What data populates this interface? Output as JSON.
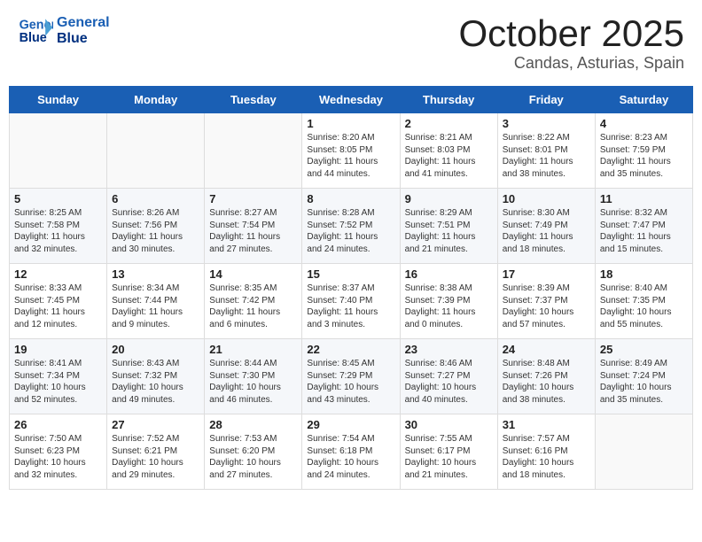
{
  "header": {
    "logo_line1": "General",
    "logo_line2": "Blue",
    "month": "October 2025",
    "location": "Candas, Asturias, Spain"
  },
  "days_of_week": [
    "Sunday",
    "Monday",
    "Tuesday",
    "Wednesday",
    "Thursday",
    "Friday",
    "Saturday"
  ],
  "weeks": [
    [
      {
        "day": "",
        "info": ""
      },
      {
        "day": "",
        "info": ""
      },
      {
        "day": "",
        "info": ""
      },
      {
        "day": "1",
        "info": "Sunrise: 8:20 AM\nSunset: 8:05 PM\nDaylight: 11 hours and 44 minutes."
      },
      {
        "day": "2",
        "info": "Sunrise: 8:21 AM\nSunset: 8:03 PM\nDaylight: 11 hours and 41 minutes."
      },
      {
        "day": "3",
        "info": "Sunrise: 8:22 AM\nSunset: 8:01 PM\nDaylight: 11 hours and 38 minutes."
      },
      {
        "day": "4",
        "info": "Sunrise: 8:23 AM\nSunset: 7:59 PM\nDaylight: 11 hours and 35 minutes."
      }
    ],
    [
      {
        "day": "5",
        "info": "Sunrise: 8:25 AM\nSunset: 7:58 PM\nDaylight: 11 hours and 32 minutes."
      },
      {
        "day": "6",
        "info": "Sunrise: 8:26 AM\nSunset: 7:56 PM\nDaylight: 11 hours and 30 minutes."
      },
      {
        "day": "7",
        "info": "Sunrise: 8:27 AM\nSunset: 7:54 PM\nDaylight: 11 hours and 27 minutes."
      },
      {
        "day": "8",
        "info": "Sunrise: 8:28 AM\nSunset: 7:52 PM\nDaylight: 11 hours and 24 minutes."
      },
      {
        "day": "9",
        "info": "Sunrise: 8:29 AM\nSunset: 7:51 PM\nDaylight: 11 hours and 21 minutes."
      },
      {
        "day": "10",
        "info": "Sunrise: 8:30 AM\nSunset: 7:49 PM\nDaylight: 11 hours and 18 minutes."
      },
      {
        "day": "11",
        "info": "Sunrise: 8:32 AM\nSunset: 7:47 PM\nDaylight: 11 hours and 15 minutes."
      }
    ],
    [
      {
        "day": "12",
        "info": "Sunrise: 8:33 AM\nSunset: 7:45 PM\nDaylight: 11 hours and 12 minutes."
      },
      {
        "day": "13",
        "info": "Sunrise: 8:34 AM\nSunset: 7:44 PM\nDaylight: 11 hours and 9 minutes."
      },
      {
        "day": "14",
        "info": "Sunrise: 8:35 AM\nSunset: 7:42 PM\nDaylight: 11 hours and 6 minutes."
      },
      {
        "day": "15",
        "info": "Sunrise: 8:37 AM\nSunset: 7:40 PM\nDaylight: 11 hours and 3 minutes."
      },
      {
        "day": "16",
        "info": "Sunrise: 8:38 AM\nSunset: 7:39 PM\nDaylight: 11 hours and 0 minutes."
      },
      {
        "day": "17",
        "info": "Sunrise: 8:39 AM\nSunset: 7:37 PM\nDaylight: 10 hours and 57 minutes."
      },
      {
        "day": "18",
        "info": "Sunrise: 8:40 AM\nSunset: 7:35 PM\nDaylight: 10 hours and 55 minutes."
      }
    ],
    [
      {
        "day": "19",
        "info": "Sunrise: 8:41 AM\nSunset: 7:34 PM\nDaylight: 10 hours and 52 minutes."
      },
      {
        "day": "20",
        "info": "Sunrise: 8:43 AM\nSunset: 7:32 PM\nDaylight: 10 hours and 49 minutes."
      },
      {
        "day": "21",
        "info": "Sunrise: 8:44 AM\nSunset: 7:30 PM\nDaylight: 10 hours and 46 minutes."
      },
      {
        "day": "22",
        "info": "Sunrise: 8:45 AM\nSunset: 7:29 PM\nDaylight: 10 hours and 43 minutes."
      },
      {
        "day": "23",
        "info": "Sunrise: 8:46 AM\nSunset: 7:27 PM\nDaylight: 10 hours and 40 minutes."
      },
      {
        "day": "24",
        "info": "Sunrise: 8:48 AM\nSunset: 7:26 PM\nDaylight: 10 hours and 38 minutes."
      },
      {
        "day": "25",
        "info": "Sunrise: 8:49 AM\nSunset: 7:24 PM\nDaylight: 10 hours and 35 minutes."
      }
    ],
    [
      {
        "day": "26",
        "info": "Sunrise: 7:50 AM\nSunset: 6:23 PM\nDaylight: 10 hours and 32 minutes."
      },
      {
        "day": "27",
        "info": "Sunrise: 7:52 AM\nSunset: 6:21 PM\nDaylight: 10 hours and 29 minutes."
      },
      {
        "day": "28",
        "info": "Sunrise: 7:53 AM\nSunset: 6:20 PM\nDaylight: 10 hours and 27 minutes."
      },
      {
        "day": "29",
        "info": "Sunrise: 7:54 AM\nSunset: 6:18 PM\nDaylight: 10 hours and 24 minutes."
      },
      {
        "day": "30",
        "info": "Sunrise: 7:55 AM\nSunset: 6:17 PM\nDaylight: 10 hours and 21 minutes."
      },
      {
        "day": "31",
        "info": "Sunrise: 7:57 AM\nSunset: 6:16 PM\nDaylight: 10 hours and 18 minutes."
      },
      {
        "day": "",
        "info": ""
      }
    ]
  ]
}
